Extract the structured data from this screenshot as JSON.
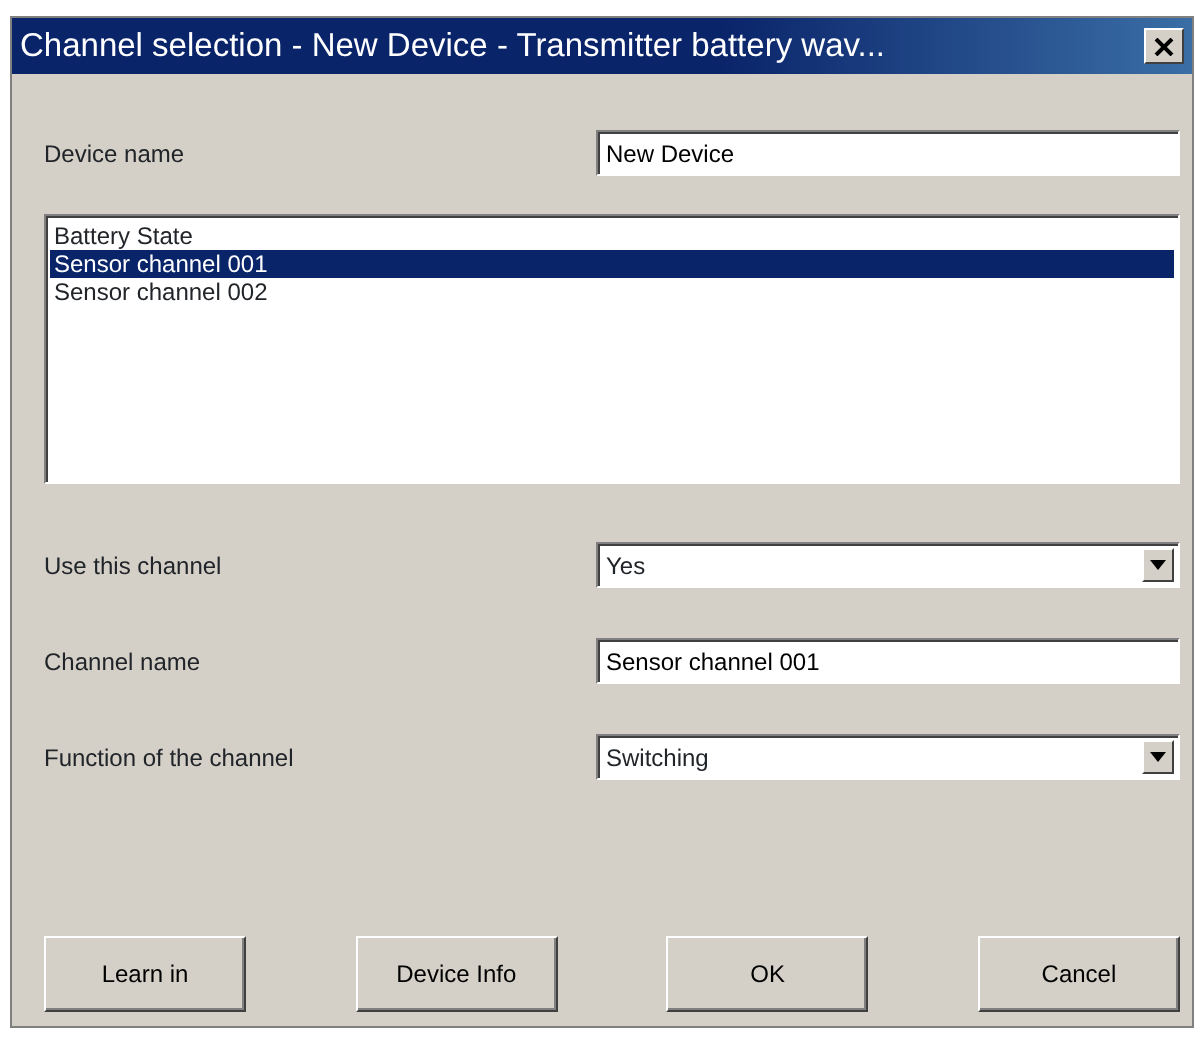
{
  "window": {
    "title": "Channel selection - New Device - Transmitter battery wav..."
  },
  "device_name": {
    "label": "Device name",
    "value": "New Device"
  },
  "channels": [
    {
      "label": "Battery State",
      "selected": false
    },
    {
      "label": "Sensor channel 001",
      "selected": true
    },
    {
      "label": "Sensor channel 002",
      "selected": false
    }
  ],
  "fields": [
    {
      "kind": "select",
      "label": "Use this channel",
      "value": "Yes"
    },
    {
      "kind": "text",
      "label": "Channel name",
      "value": "Sensor channel 001"
    },
    {
      "kind": "select",
      "label": "Function of the channel",
      "value": "Switching"
    }
  ],
  "buttons": [
    "Learn in",
    "Device Info",
    "OK",
    "Cancel"
  ]
}
